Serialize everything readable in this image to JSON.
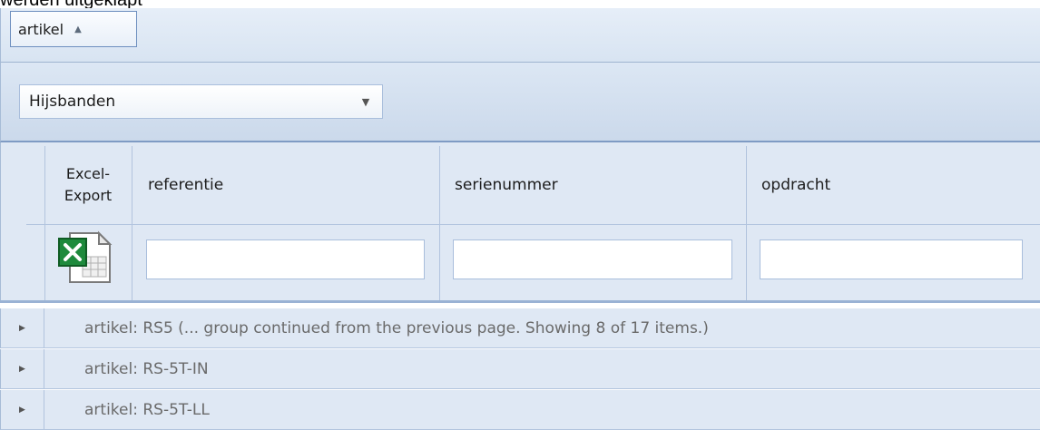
{
  "caption": "werden uitgeklapt",
  "group_panel": {
    "chip_label": "artikel",
    "chip_sort_icon": "sort-ascending-icon"
  },
  "filter_bar": {
    "combo_value": "Hijsbanden",
    "combo_arrow_icon": "chevron-down-icon"
  },
  "grid": {
    "columns": [
      {
        "label_line1": "Excel-",
        "label_line2": "Export"
      },
      {
        "label": "referentie"
      },
      {
        "label": "serienummer"
      },
      {
        "label": "opdracht"
      }
    ],
    "export_icon": "excel-icon",
    "filter_values": [
      "",
      "",
      ""
    ],
    "group_rows": [
      {
        "text": "artikel: RS5 (... group continued from the previous page. Showing 8 of 17 items.)"
      },
      {
        "text": "artikel: RS-5T-IN"
      },
      {
        "text": "artikel: RS-5T-LL"
      }
    ]
  },
  "colors": {
    "header_bg": "#dfe8f4",
    "border": "#a7bcd7",
    "accent": "#6d8fbf"
  }
}
